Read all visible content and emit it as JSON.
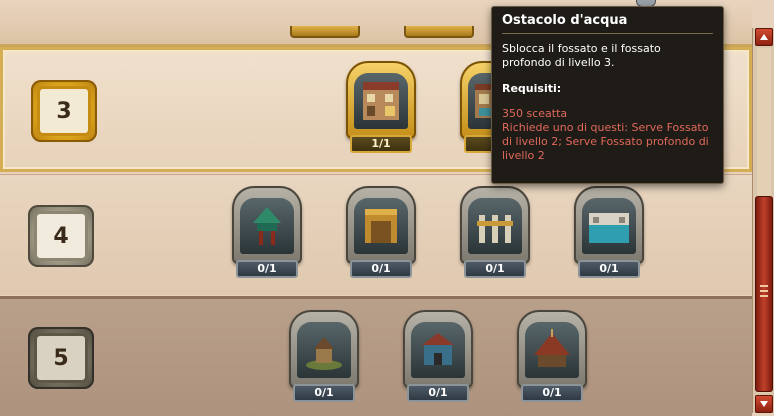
{
  "levels": [
    {
      "label": "3",
      "cards": [
        {
          "count": "1/1"
        },
        {
          "count": "1"
        }
      ]
    },
    {
      "label": "4",
      "cards": [
        {
          "count": "0/1"
        },
        {
          "count": "0/1"
        },
        {
          "count": "0/1"
        },
        {
          "count": "0/1"
        }
      ]
    },
    {
      "label": "5",
      "cards": [
        {
          "count": "0/1"
        },
        {
          "count": "0/1"
        },
        {
          "count": "0/1"
        }
      ]
    }
  ],
  "tooltip": {
    "title": "Ostacolo d'acqua",
    "description": "Sblocca il fossato e il fossato profondo di livello 3.",
    "requirements_label": "Requisiti:",
    "cost": "350 sceatta",
    "requirement": "Richiede uno di questi: Serve Fossato di livello 2; Serve Fossato profondo di livello 2"
  },
  "icons": [
    "chevron-up-icon",
    "chevron-down-icon",
    "grip-icon"
  ],
  "colors": {
    "accent_gold": "#d4ad55",
    "tooltip_bg": "#1f1b17",
    "requirement_text": "#e06a5a",
    "scroll_red": "#c1402a"
  }
}
